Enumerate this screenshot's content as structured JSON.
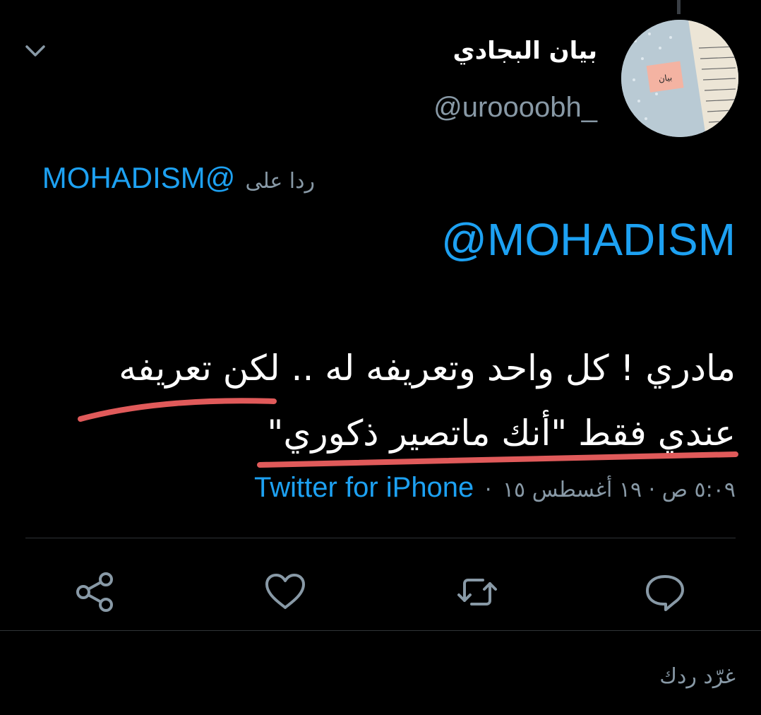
{
  "tweet": {
    "display_name": "بيان البجادي",
    "handle": "@uroooobh_",
    "reply_prefix": "ردا على",
    "reply_to": "@MOHADISM",
    "mention": "@MOHADISM",
    "text_line_1": "مادري ! كل واحد وتعريفه له .. لكن تعريفه",
    "text_line_2": "عندي فقط \"أنك ماتصير ذكوري\"",
    "timestamp": "٥:٠٩ ص · ١٩ أغسطس ١٥",
    "separator": "·",
    "source": "Twitter for iPhone",
    "avatar_note": "بيان"
  },
  "actions": {
    "reply_icon": "reply-icon",
    "retweet_icon": "retweet-icon",
    "like_icon": "heart-icon",
    "share_icon": "share-icon"
  },
  "composer": {
    "placeholder": "غرّد ردك"
  },
  "colors": {
    "background": "#000000",
    "accent": "#1da1f2",
    "muted": "#8899a6",
    "divider": "#2f3336",
    "annotation": "#e05a5a"
  }
}
